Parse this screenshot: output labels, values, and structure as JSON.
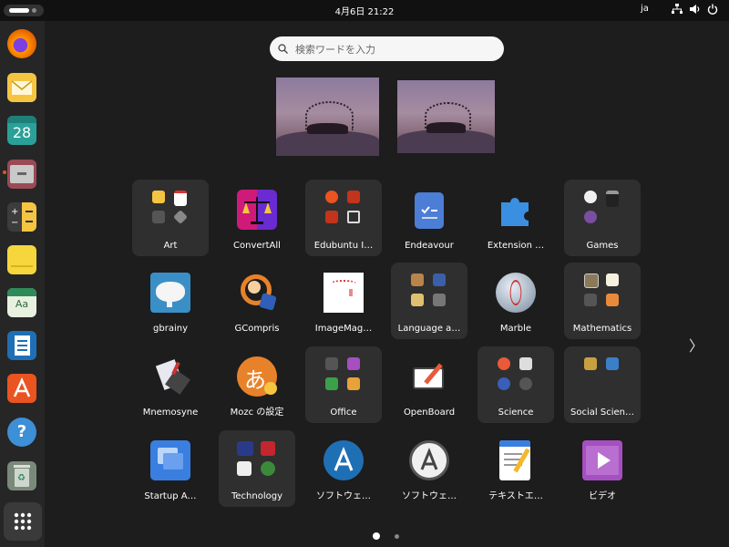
{
  "topbar": {
    "clock": "4月6日  21:22",
    "lang": "ja",
    "icons": [
      "network-icon",
      "volume-icon",
      "power-icon"
    ]
  },
  "dock": {
    "items": [
      {
        "name": "firefox",
        "color": "#e66000"
      },
      {
        "name": "mail",
        "color": "#f5c542"
      },
      {
        "name": "calendar",
        "text": "28",
        "color": "#2aa198"
      },
      {
        "name": "files",
        "color": "#9a4a55",
        "running": true
      },
      {
        "name": "calculator",
        "color": "#3c3c3c"
      },
      {
        "name": "notes",
        "color": "#f5d63c"
      },
      {
        "name": "dictionary",
        "text": "Aa",
        "color": "#e8f0e0"
      },
      {
        "name": "writer",
        "color": "#1f6fb5"
      },
      {
        "name": "app-center",
        "color": "#e95420"
      },
      {
        "name": "help",
        "text": "?",
        "color": "#3d8fd6"
      },
      {
        "name": "trash",
        "color": "#7a8a7a"
      }
    ]
  },
  "search": {
    "placeholder": "検索ワードを入力"
  },
  "apps": [
    {
      "label": "Art",
      "folder": true
    },
    {
      "label": "ConvertAll",
      "folder": false
    },
    {
      "label": "Edubuntu I…",
      "folder": true
    },
    {
      "label": "Endeavour",
      "folder": false
    },
    {
      "label": "Extension …",
      "folder": false
    },
    {
      "label": "Games",
      "folder": true
    },
    {
      "label": "gbrainy",
      "folder": false
    },
    {
      "label": "GCompris",
      "folder": false
    },
    {
      "label": "ImageMag…",
      "folder": false
    },
    {
      "label": "Language a…",
      "folder": true
    },
    {
      "label": "Marble",
      "folder": false
    },
    {
      "label": "Mathematics",
      "folder": true
    },
    {
      "label": "Mnemosyne",
      "folder": false
    },
    {
      "label": "Mozc の設定",
      "folder": false
    },
    {
      "label": "Office",
      "folder": true
    },
    {
      "label": "OpenBoard",
      "folder": false
    },
    {
      "label": "Science",
      "folder": true
    },
    {
      "label": "Social Scien…",
      "folder": true
    },
    {
      "label": "Startup A…",
      "folder": false
    },
    {
      "label": "Technology",
      "folder": true
    },
    {
      "label": "ソフトウェ…",
      "folder": false
    },
    {
      "label": "ソフトウェ…",
      "folder": false
    },
    {
      "label": "テキストエ…",
      "folder": false
    },
    {
      "label": "ビデオ",
      "folder": false
    }
  ],
  "pagination": {
    "pages": 2,
    "current": 1
  },
  "mozc_glyph": "あ"
}
